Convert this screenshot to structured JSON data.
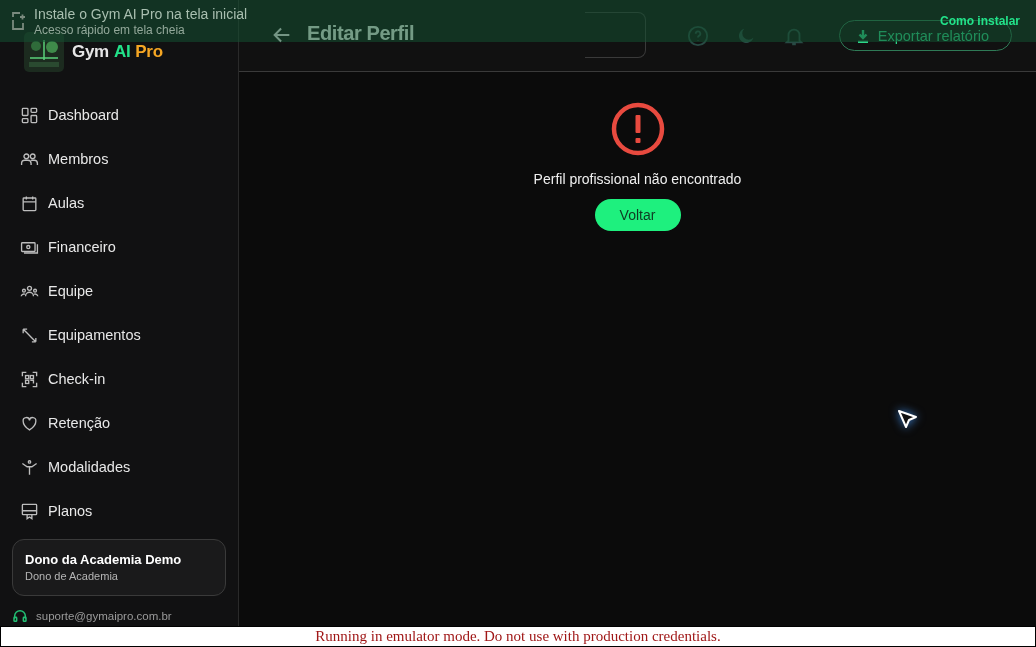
{
  "install_banner": {
    "title": "Instale o Gym AI Pro na tela inicial",
    "subtitle": "Acesso rápido em tela cheia",
    "action": "Como instalar"
  },
  "brand": {
    "parts": [
      {
        "text": "Gym",
        "kind": "plain"
      },
      {
        "text": "AI",
        "kind": "accent"
      },
      {
        "text": "Pro",
        "kind": "highlight"
      }
    ]
  },
  "sidebar": {
    "items": [
      {
        "label": "Dashboard",
        "selected": false
      },
      {
        "label": "Membros",
        "selected": false
      },
      {
        "label": "Aulas",
        "selected": false
      },
      {
        "label": "Financeiro",
        "selected": false
      },
      {
        "label": "Equipe",
        "selected": false
      },
      {
        "label": "Equipamentos",
        "selected": false
      },
      {
        "label": "Check-in",
        "selected": false
      },
      {
        "label": "Retenção",
        "selected": false
      },
      {
        "label": "Modalidades",
        "selected": false
      },
      {
        "label": "Planos",
        "selected": false
      }
    ],
    "user": {
      "name": "Dono da Academia Demo",
      "role": "Dono de Academia"
    },
    "support": "suporte@gymaipro.com.br"
  },
  "header": {
    "title": "Editar Perfil",
    "export_button": "Exportar relatório"
  },
  "message": {
    "text": "Perfil profissional não encontrado",
    "button": "Voltar"
  },
  "emulator_notice": "Running in emulator mode. Do not use with production credentials."
}
